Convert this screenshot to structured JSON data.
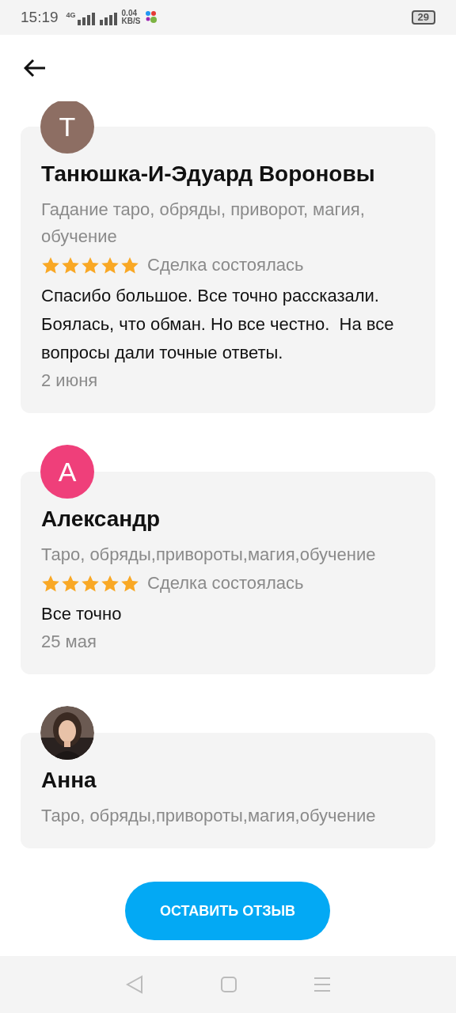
{
  "status_bar": {
    "time": "15:19",
    "network": "4G",
    "speed": "0.04",
    "speed_unit": "KB/S",
    "battery": "29"
  },
  "reviews": [
    {
      "avatar": {
        "kind": "letter",
        "letter": "Т",
        "color": "#8d6e63"
      },
      "name": "Танюшка-И-Эдуард Вороновы",
      "tags": "Гадание таро, обряды, приворот, магия, обучение",
      "stars": 5,
      "status": "Сделка состоялась",
      "text": "Спасибо большое. Все точно рассказали.  Боялась, что обман. Но все честно.  На все вопросы дали точные ответы.",
      "date": "2 июня"
    },
    {
      "avatar": {
        "kind": "letter",
        "letter": "А",
        "color": "#ef3f7a"
      },
      "name": "Александр",
      "tags": "Таро, обряды,привороты,магия,обучение",
      "stars": 5,
      "status": "Сделка состоялась",
      "text": "Все точно",
      "date": "25 мая"
    },
    {
      "name": "Анна",
      "tags": "Таро, обряды,привороты,магия,обучение"
    }
  ],
  "action_button": "ОСТАВИТЬ ОТЗЫВ"
}
